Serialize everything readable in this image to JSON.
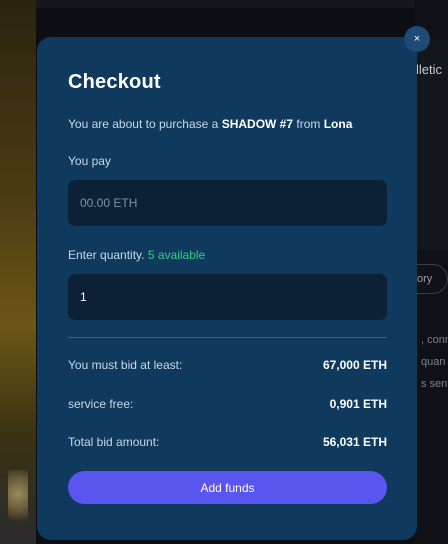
{
  "background": {
    "right_text_1": "lletic",
    "right_chip": "ory",
    "right_text_2": ", conn",
    "right_text_3": "quan",
    "right_text_4": "s sent"
  },
  "modal": {
    "close_label": "×",
    "title": "Checkout",
    "purchase": {
      "prefix": "You are about to purchase a",
      "item": "SHADOW #7",
      "middle": "from",
      "seller": "Lona"
    },
    "pay": {
      "label": "You pay",
      "placeholder": "00.00 ETH"
    },
    "quantity": {
      "label": "Enter quantity.",
      "available": "5 available",
      "value": "1"
    },
    "summary": [
      {
        "label": "You must bid at least:",
        "value": "67,000 ETH"
      },
      {
        "label": "service free:",
        "value": "0,901 ETH"
      },
      {
        "label": "Total bid amount:",
        "value": "56,031 ETH"
      }
    ],
    "button_label": "Add funds"
  },
  "colors": {
    "modal_bg": "#0f3a5e",
    "input_bg": "#0c2136",
    "accent_button": "#5b55f0",
    "available_green": "#2ecf7c"
  }
}
